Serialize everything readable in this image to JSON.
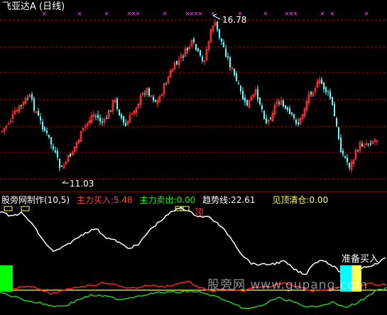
{
  "window": {
    "title": "飞亚达A (日线)"
  },
  "price_panel": {
    "high_label": "16.78",
    "low_label": "11.03"
  },
  "indicator": {
    "name": "股旁网制作(10,5)",
    "main_buy": "主力买入:5.48",
    "main_sell": "主力卖出:0.00",
    "trend": "趋势线:22.61",
    "top_clear": "见顶清仓:0.00"
  },
  "signals": {
    "top_label": "顶",
    "buy_label": "准备买入"
  },
  "watermark": "股旁网 www.gupang.com",
  "colors": {
    "background": "#000000",
    "up_candle": "#ff3030",
    "down_candle": "#54ffff",
    "grid": "#b00000",
    "top_marker": "#ff40ff",
    "trend_line": "#ffffff",
    "main_line": "#ff2020",
    "green_line": "#20d020",
    "baseline": "#ffff40",
    "green_bar": "#00ff00",
    "cyan_bar": "#00ffff",
    "yellow_bar": "#ffff55",
    "main_buy_text": "#ff4040",
    "main_sell_text": "#00ff00",
    "trend_text": "#ffffff",
    "top_clear_text": "#ffff40"
  }
}
